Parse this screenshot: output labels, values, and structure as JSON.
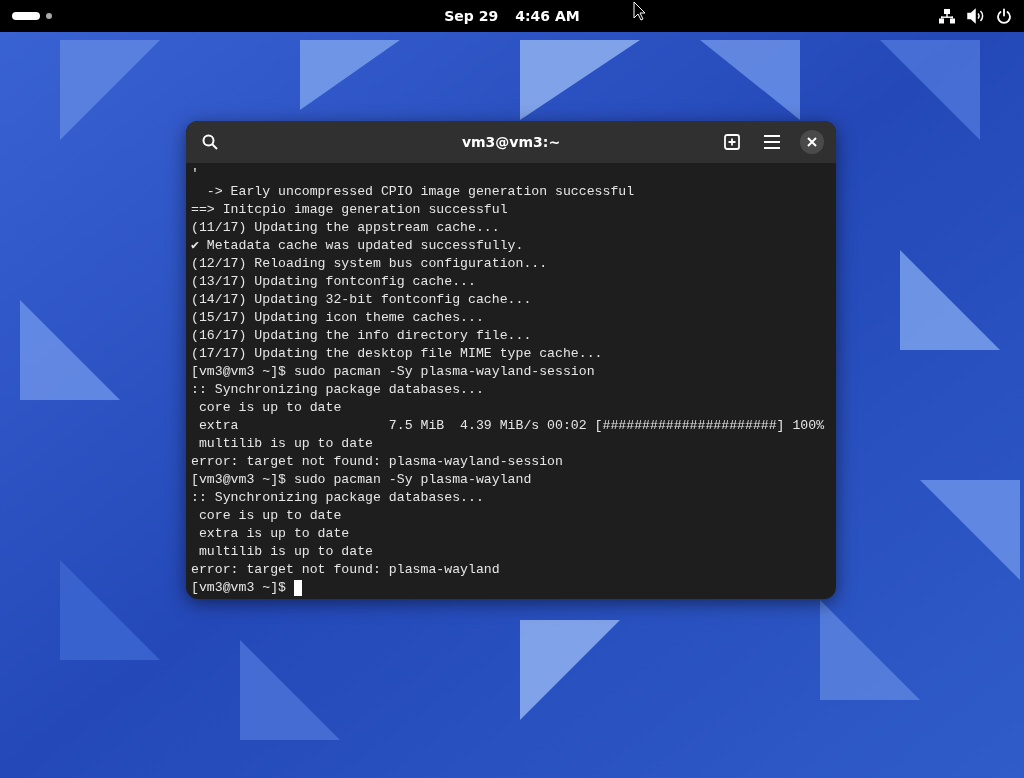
{
  "top_bar": {
    "date": "Sep 29",
    "time": "4:46 AM"
  },
  "terminal": {
    "title": "vm3@vm3:~",
    "lines": [
      "'",
      "  -> Early uncompressed CPIO image generation successful",
      "==> Initcpio image generation successful",
      "(11/17) Updating the appstream cache...",
      "✔ Metadata cache was updated successfully.",
      "(12/17) Reloading system bus configuration...",
      "(13/17) Updating fontconfig cache...",
      "(14/17) Updating 32-bit fontconfig cache...",
      "(15/17) Updating icon theme caches...",
      "(16/17) Updating the info directory file...",
      "(17/17) Updating the desktop file MIME type cache...",
      "[vm3@vm3 ~]$ sudo pacman -Sy plasma-wayland-session",
      ":: Synchronizing package databases...",
      " core is up to date",
      " extra                   7.5 MiB  4.39 MiB/s 00:02 [######################] 100%",
      " multilib is up to date",
      "error: target not found: plasma-wayland-session",
      "[vm3@vm3 ~]$ sudo pacman -Sy plasma-wayland",
      ":: Synchronizing package databases...",
      " core is up to date",
      " extra is up to date",
      " multilib is up to date",
      "error: target not found: plasma-wayland"
    ],
    "prompt": "[vm3@vm3 ~]$"
  }
}
